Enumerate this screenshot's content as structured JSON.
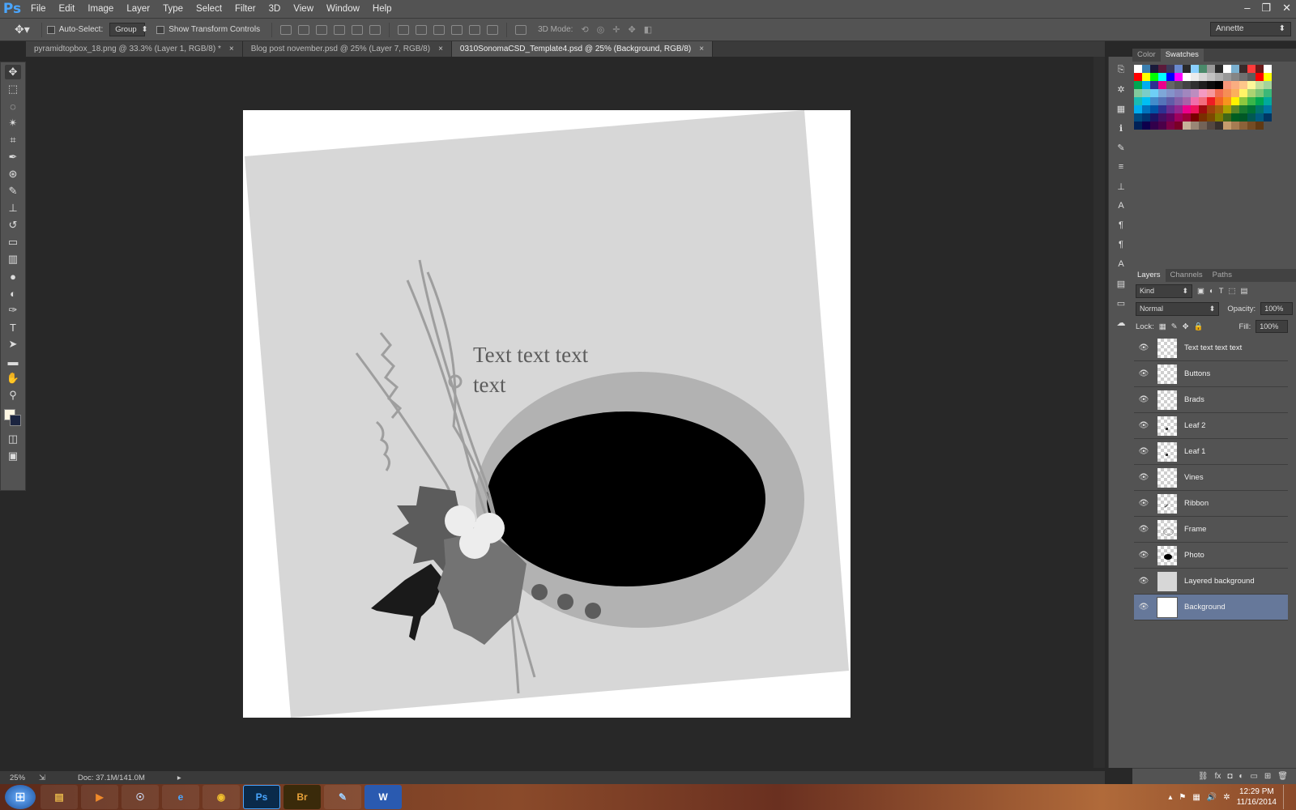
{
  "menu": {
    "logo": "Ps",
    "items": [
      "File",
      "Edit",
      "Image",
      "Layer",
      "Type",
      "Select",
      "Filter",
      "3D",
      "View",
      "Window",
      "Help"
    ]
  },
  "options": {
    "auto_select_label": "Auto-Select:",
    "auto_select_value": "Group",
    "transform_label": "Show Transform Controls",
    "mode_3d_label": "3D Mode:",
    "workspace": "Annette"
  },
  "tabs": [
    {
      "label": "pyramidtopbox_18.png @ 33.3% (Layer 1, RGB/8) *",
      "active": false
    },
    {
      "label": "Blog post november.psd @ 25% (Layer 7, RGB/8)",
      "active": false
    },
    {
      "label": "0310SonomaCSD_Template4.psd @ 25% (Background, RGB/8)",
      "active": true
    }
  ],
  "canvas": {
    "text_line1": "Text text text",
    "text_line2": "text"
  },
  "status": {
    "zoom": "25%",
    "doc": "Doc: 37.1M/141.0M"
  },
  "panels": {
    "color_tab": "Color",
    "swatches_tab": "Swatches",
    "layers_tab": "Layers",
    "channels_tab": "Channels",
    "paths_tab": "Paths",
    "kind_label": "Kind",
    "blend_mode": "Normal",
    "opacity_label": "Opacity:",
    "opacity_value": "100%",
    "lock_label": "Lock:",
    "fill_label": "Fill:",
    "fill_value": "100%"
  },
  "swatch_rows": [
    [
      "#ffffff",
      "#3b7fb0",
      "#1a1a3a",
      "#5a1a3a",
      "#3a3a5a",
      "#6a8acf",
      "#2a2a2a",
      "#8ad0ff",
      "#4a8a6a",
      "#9a9a9a",
      "#2a2a2a",
      "#ffffff",
      "#7ab0cf",
      "#3a2a2a",
      "#ff3a3a",
      "#6a1a1a",
      "#ffffff"
    ],
    [
      "#ff0000",
      "#ffff00",
      "#00ff00",
      "#00ffff",
      "#0000ff",
      "#ff00ff",
      "#ffffff",
      "#ebebeb",
      "#d6d6d6",
      "#c2c2c2",
      "#adadad",
      "#999999",
      "#858585",
      "#707070",
      "#5c5c5c",
      "#ff0000",
      "#ffff00"
    ],
    [
      "#00a651",
      "#00aeef",
      "#2e3192",
      "#ec008c",
      "#666666",
      "#545454",
      "#424242",
      "#303030",
      "#1e1e1e",
      "#0c0c0c",
      "#000000",
      "#f7977a",
      "#f9ad81",
      "#fdc68a",
      "#fff79a",
      "#c4df9b",
      "#a3d39c"
    ],
    [
      "#82ca9d",
      "#7bcdc8",
      "#6ecff6",
      "#7ea7d8",
      "#8493ca",
      "#8882be",
      "#a187be",
      "#bc8dbf",
      "#f49ac2",
      "#f6989d",
      "#f26c4f",
      "#f68e55",
      "#fbaf5c",
      "#fff467",
      "#acd372",
      "#7cc576",
      "#3bb878"
    ],
    [
      "#1abbb4",
      "#00bff3",
      "#438ccb",
      "#5574b9",
      "#605ca8",
      "#855fa8",
      "#a763a8",
      "#f06eaa",
      "#f26d7d",
      "#ed1c24",
      "#f26522",
      "#f7941d",
      "#fff200",
      "#8dc73f",
      "#39b54a",
      "#00a651",
      "#00a99d"
    ],
    [
      "#00aeef",
      "#0072bc",
      "#0054a6",
      "#2e3192",
      "#662d91",
      "#92278f",
      "#ec008c",
      "#ed145b",
      "#9e0b0f",
      "#a0410d",
      "#a3620a",
      "#aba000",
      "#598527",
      "#197b30",
      "#007236",
      "#00746b",
      "#0076a3"
    ],
    [
      "#004a80",
      "#003471",
      "#1b1464",
      "#440e62",
      "#630460",
      "#9e005d",
      "#9e0039",
      "#790000",
      "#7b2e00",
      "#7d4900",
      "#827b00",
      "#406618",
      "#005e20",
      "#005826",
      "#005952",
      "#005b7f",
      "#003663"
    ],
    [
      "#002157",
      "#0d004c",
      "#32004b",
      "#4b0049",
      "#7b0046",
      "#7a0026",
      "#c7b299",
      "#998675",
      "#736357",
      "#534741",
      "#37302d",
      "#c69c6d",
      "#a67c52",
      "#8c6239",
      "#754c24",
      "#603913"
    ]
  ],
  "layers": [
    {
      "name": "Text text text text",
      "selected": false,
      "thumb": "blank"
    },
    {
      "name": "Buttons",
      "selected": false,
      "thumb": "blank"
    },
    {
      "name": "Brads",
      "selected": false,
      "thumb": "blank"
    },
    {
      "name": "Leaf 2",
      "selected": false,
      "thumb": "dot"
    },
    {
      "name": "Leaf 1",
      "selected": false,
      "thumb": "dot"
    },
    {
      "name": "Vines",
      "selected": false,
      "thumb": "blank"
    },
    {
      "name": "Ribbon",
      "selected": false,
      "thumb": "line"
    },
    {
      "name": "Frame",
      "selected": false,
      "thumb": "ring"
    },
    {
      "name": "Photo",
      "selected": false,
      "thumb": "oval"
    },
    {
      "name": "Layered background",
      "selected": false,
      "thumb": "gray"
    },
    {
      "name": "Background",
      "selected": true,
      "thumb": "white"
    }
  ],
  "taskbar": {
    "apps": [
      {
        "name": "Explorer",
        "label": "▤",
        "color": "#e8b84a"
      },
      {
        "name": "Media",
        "label": "▶",
        "color": "#f08a2a"
      },
      {
        "name": "Steam",
        "label": "☉",
        "color": "#cfe2ff"
      },
      {
        "name": "IE",
        "label": "e",
        "color": "#4aa6ff"
      },
      {
        "name": "Chrome",
        "label": "◉",
        "color": "#f2c12e"
      },
      {
        "name": "Photoshop",
        "label": "Ps",
        "color": "#4aa6ff"
      },
      {
        "name": "Bridge",
        "label": "Br",
        "color": "#e7a13a"
      },
      {
        "name": "Paint",
        "label": "✎",
        "color": "#9fd0ff"
      },
      {
        "name": "Word",
        "label": "W",
        "color": "#ffffff"
      }
    ],
    "time": "12:29 PM",
    "date": "11/16/2014"
  },
  "colors": {
    "foreground": "#fdf6e3",
    "background": "#1b2440",
    "selected_layer": "#66789a"
  }
}
